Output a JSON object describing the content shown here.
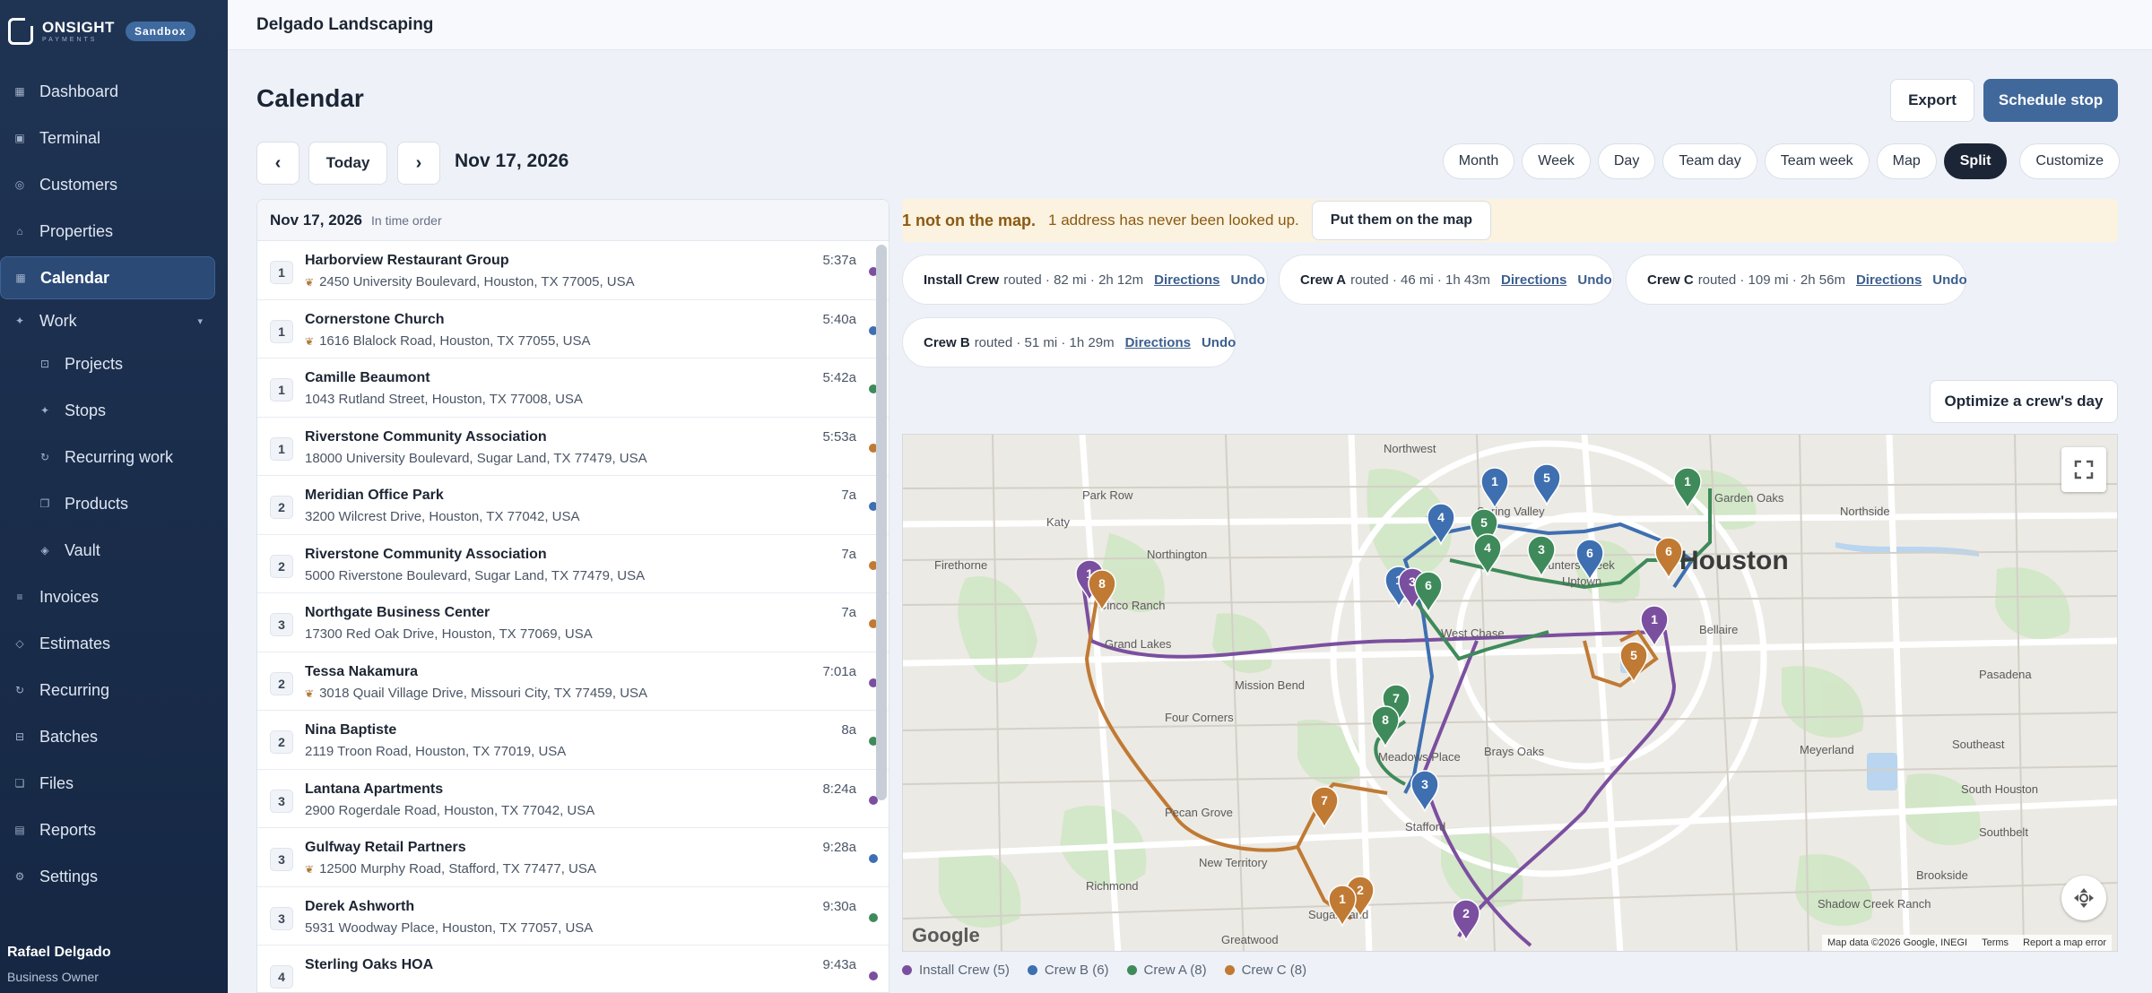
{
  "brand": {
    "name": "ONSIGHT",
    "sub": "PAYMENTS",
    "badge": "Sandbox"
  },
  "sidebar": {
    "items": [
      {
        "label": "Dashboard",
        "icon": "grid-icon"
      },
      {
        "label": "Terminal",
        "icon": "terminal-icon"
      },
      {
        "label": "Customers",
        "icon": "customers-icon"
      },
      {
        "label": "Properties",
        "icon": "home-icon"
      },
      {
        "label": "Calendar",
        "icon": "calendar-icon"
      },
      {
        "label": "Work",
        "icon": "sparkle-icon"
      },
      {
        "label": "Projects",
        "icon": "projects-icon"
      },
      {
        "label": "Stops",
        "icon": "stops-icon"
      },
      {
        "label": "Recurring work",
        "icon": "recurring-icon"
      },
      {
        "label": "Products",
        "icon": "products-icon"
      },
      {
        "label": "Vault",
        "icon": "vault-icon"
      },
      {
        "label": "Invoices",
        "icon": "invoice-icon"
      },
      {
        "label": "Estimates",
        "icon": "estimate-icon"
      },
      {
        "label": "Recurring",
        "icon": "refresh-icon"
      },
      {
        "label": "Batches",
        "icon": "batches-icon"
      },
      {
        "label": "Files",
        "icon": "files-icon"
      },
      {
        "label": "Reports",
        "icon": "reports-icon"
      },
      {
        "label": "Settings",
        "icon": "settings-icon"
      }
    ]
  },
  "user": {
    "name": "Rafael Delgado",
    "role": "Business Owner"
  },
  "topbar": {
    "company": "Delgado Landscaping"
  },
  "header": {
    "title": "Calendar",
    "export_label": "Export",
    "schedule_label": "Schedule stop",
    "prev_label": "‹",
    "today_label": "Today",
    "next_label": "›",
    "date": "Nov 17, 2026"
  },
  "views": [
    "Month",
    "Week",
    "Day",
    "Team day",
    "Team week",
    "Map",
    "Split",
    "Customize"
  ],
  "list": {
    "date": "Nov 17, 2026",
    "sub": "In time order",
    "rows": [
      {
        "num": "1",
        "name": "Harborview Restaurant Group",
        "addr": "2450 University Boulevard, Houston, TX 77005, USA",
        "time": "5:37a",
        "color": "#7b4fa0",
        "leaf": true
      },
      {
        "num": "1",
        "name": "Cornerstone Church",
        "addr": "1616 Blalock Road, Houston, TX 77055, USA",
        "time": "5:40a",
        "color": "#3e6fb0",
        "leaf": true
      },
      {
        "num": "1",
        "name": "Camille Beaumont",
        "addr": "1043 Rutland Street, Houston, TX 77008, USA",
        "time": "5:42a",
        "color": "#3f8a5a",
        "leaf": false
      },
      {
        "num": "1",
        "name": "Riverstone Community Association",
        "addr": "18000 University Boulevard, Sugar Land, TX 77479, USA",
        "time": "5:53a",
        "color": "#c07a34",
        "leaf": false
      },
      {
        "num": "2",
        "name": "Meridian Office Park",
        "addr": "3200 Wilcrest Drive, Houston, TX 77042, USA",
        "time": "7a",
        "color": "#3e6fb0",
        "leaf": false
      },
      {
        "num": "2",
        "name": "Riverstone Community Association",
        "addr": "5000 Riverstone Boulevard, Sugar Land, TX 77479, USA",
        "time": "7a",
        "color": "#c07a34",
        "leaf": false
      },
      {
        "num": "3",
        "name": "Northgate Business Center",
        "addr": "17300 Red Oak Drive, Houston, TX 77069, USA",
        "time": "7a",
        "color": "#c07a34",
        "leaf": false
      },
      {
        "num": "2",
        "name": "Tessa Nakamura",
        "addr": "3018 Quail Village Drive, Missouri City, TX 77459, USA",
        "time": "7:01a",
        "color": "#7b4fa0",
        "leaf": true
      },
      {
        "num": "2",
        "name": "Nina Baptiste",
        "addr": "2119 Troon Road, Houston, TX 77019, USA",
        "time": "8a",
        "color": "#3f8a5a",
        "leaf": false
      },
      {
        "num": "3",
        "name": "Lantana Apartments",
        "addr": "2900 Rogerdale Road, Houston, TX 77042, USA",
        "time": "8:24a",
        "color": "#7b4fa0",
        "leaf": false
      },
      {
        "num": "3",
        "name": "Gulfway Retail Partners",
        "addr": "12500 Murphy Road, Stafford, TX 77477, USA",
        "time": "9:28a",
        "color": "#3e6fb0",
        "leaf": true
      },
      {
        "num": "3",
        "name": "Derek Ashworth",
        "addr": "5931 Woodway Place, Houston, TX 77057, USA",
        "time": "9:30a",
        "color": "#3f8a5a",
        "leaf": false
      },
      {
        "num": "4",
        "name": "Sterling Oaks HOA",
        "addr": "",
        "time": "9:43a",
        "color": "#7b4fa0",
        "leaf": false
      }
    ]
  },
  "alert": {
    "strong": "1 not on the map.",
    "text": "1 address has never been looked up.",
    "button": "Put them on the map"
  },
  "routes": [
    {
      "crew": "Install Crew",
      "color": "#7b4fa0",
      "info": "routed · 82 mi · 2h 12m",
      "directions": "Directions",
      "undo": "Undo"
    },
    {
      "crew": "Crew A",
      "color": "#3f8a5a",
      "info": "routed · 46 mi · 1h 43m",
      "directions": "Directions",
      "undo": "Undo"
    },
    {
      "crew": "Crew C",
      "color": "#c07a34",
      "info": "routed · 109 mi · 2h 56m",
      "directions": "Directions",
      "undo": "Undo"
    },
    {
      "crew": "Crew B",
      "color": "#3e6fb0",
      "info": "routed · 51 mi · 1h 29m",
      "directions": "Directions",
      "undo": "Undo"
    }
  ],
  "optimize_label": "Optimize a crew's day",
  "map": {
    "city": "Houston",
    "places": [
      "Park Row",
      "Katy",
      "Cinco Ranch",
      "Firethorne",
      "Grand Lakes",
      "Northwest",
      "Northington",
      "Spring Valley",
      "Hunters Creek",
      "Uptown",
      "Bellaire",
      "West Chase",
      "Mission Bend",
      "Four Corners",
      "Brays Oaks",
      "Meadows Place",
      "Stafford",
      "Pecan Grove",
      "Sugar Land",
      "Richmond",
      "New Territory",
      "Greatwood",
      "Pasadena",
      "Meyerland",
      "Southeast",
      "South Houston",
      "Southbelt",
      "Brookside",
      "Shadow Creek Ranch",
      "Northside",
      "Garden Oaks"
    ],
    "attribution": "Map data ©2026 Google, INEGI",
    "terms": "Terms",
    "report": "Report a map error",
    "google": "Google"
  },
  "legend": [
    {
      "label": "Install Crew (5)",
      "color": "#7b4fa0"
    },
    {
      "label": "Crew B (6)",
      "color": "#3e6fb0"
    },
    {
      "label": "Crew A (8)",
      "color": "#3f8a5a"
    },
    {
      "label": "Crew C (8)",
      "color": "#c07a34"
    }
  ]
}
